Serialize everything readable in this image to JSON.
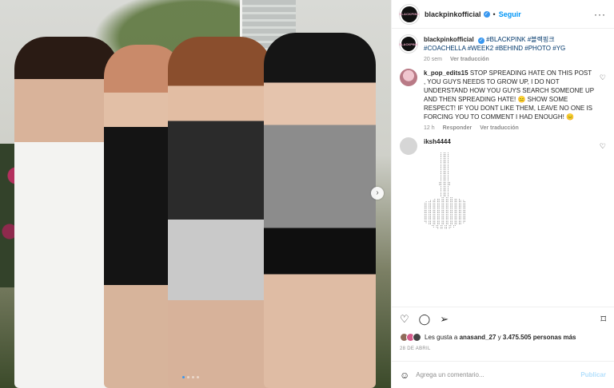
{
  "post": {
    "username": "blackpinkofficial",
    "follow_label": "Seguir",
    "separator": "•",
    "more_icon": "more-horizontal-icon",
    "avatar_logo": "BLACKPINK"
  },
  "caption": {
    "username": "blackpinkofficial",
    "hashtags": "#BLACKPINK #블랙핑크 #COACHELLA #WEEK2 #BEHIND #PHOTO #YG",
    "time": "20 sem",
    "translation": "Ver traducción"
  },
  "comments": [
    {
      "username": "k_pop_edits15",
      "text": "STOP SPREADING HATE ON THIS POST , YOU GUYS NEEDS TO GROW UP, I DO NOT UNDERSTAND HOW YOU GUYS SEARCH SOMEONE UP AND THEN SPREADING HATE! 😑 SHOW SOME RESPECT! IF YOU DONT LIKE THEM, LEAVE NO ONE IS FORCING YOU TO COMMENT I HAD ENOUGH! 😑",
      "time": "12 h",
      "reply": "Responder",
      "translation": "Ver traducción"
    },
    {
      "username": "iksh4444",
      "ascii": "    ⢸⣿⡇\n    ⢸⣿⡇\n    ⢸⣿⡇\n    ⢸⣿⡇\n    ⢸⣿⡇\n    ⣾⣿⣷\n    ⢸⣿⡇\n    ⢸⣿⡇\n⢀⣠⣴⣶⣿⣿⣿⣶⣦⣄\n⣿⣿⣿⣿⣿⣿⣿⣿⣿⣿\n⣿⣿⣿⣿⣿⣿⣿⣿⣿⣿\n⣿⣿⣿⣿⣿⣿⣿⣿⣿⣿\n⠻⣿⣿⣿⣿⣿⣿⣿⣿⠟\n  ⠙⠻⠿⠿⠟⠋"
    }
  ],
  "actions": {
    "like_icon": "heart-icon",
    "comment_icon": "comment-icon",
    "share_icon": "paper-plane-icon",
    "save_icon": "bookmark-icon"
  },
  "likes": {
    "prefix": "Les gusta a",
    "user": "anasand_27",
    "middle": "y",
    "count": "3.475.505 personas más"
  },
  "date": "28 DE ABRIL",
  "composer": {
    "placeholder": "Agrega un comentario...",
    "publish_label": "Publicar"
  },
  "media": {
    "carousel_total": 4,
    "carousel_active": 1
  }
}
